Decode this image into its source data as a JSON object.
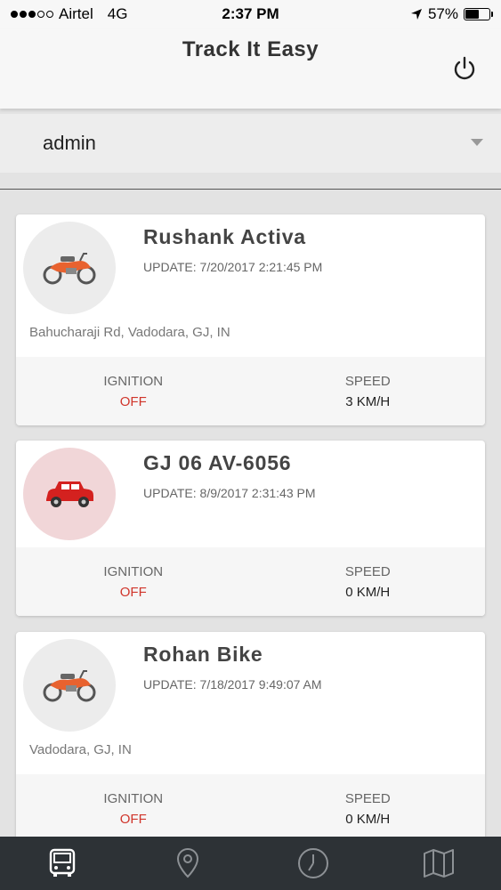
{
  "status_bar": {
    "carrier": "Airtel",
    "network": "4G",
    "time": "2:37 PM",
    "battery": "57%",
    "battery_fraction": 0.57
  },
  "header": {
    "title": "Track It Easy",
    "power_icon": "power-icon"
  },
  "user_select": {
    "value": "admin"
  },
  "vehicles": [
    {
      "name": "Rushank Activa",
      "update": "UPDATE: 7/20/2017 2:21:45 PM",
      "address": "Bahucharaji Rd, Vadodara, GJ, IN",
      "icon": "motorcycle-icon",
      "ignition_label": "IGNITION",
      "ignition": "OFF",
      "speed_label": "SPEED",
      "speed": "3 KM/H"
    },
    {
      "name": "GJ 06 AV-6056",
      "update": "UPDATE: 8/9/2017 2:31:43 PM",
      "address": "",
      "icon": "car-icon",
      "ignition_label": "IGNITION",
      "ignition": "OFF",
      "speed_label": "SPEED",
      "speed": "0 KM/H"
    },
    {
      "name": "Rohan Bike",
      "update": "UPDATE: 7/18/2017 9:49:07 AM",
      "address": "Vadodara, GJ, IN",
      "icon": "motorcycle-icon",
      "ignition_label": "IGNITION",
      "ignition": "OFF",
      "speed_label": "SPEED",
      "speed": "0 KM/H"
    }
  ],
  "tabs": [
    {
      "icon": "bus-icon",
      "active": true
    },
    {
      "icon": "location-pin-icon",
      "active": false
    },
    {
      "icon": "clock-icon",
      "active": false
    },
    {
      "icon": "map-icon",
      "active": false
    }
  ],
  "colors": {
    "accent_red": "#d0352b",
    "tab_bar": "#2d3236",
    "header_bg": "#f7f7f7"
  }
}
